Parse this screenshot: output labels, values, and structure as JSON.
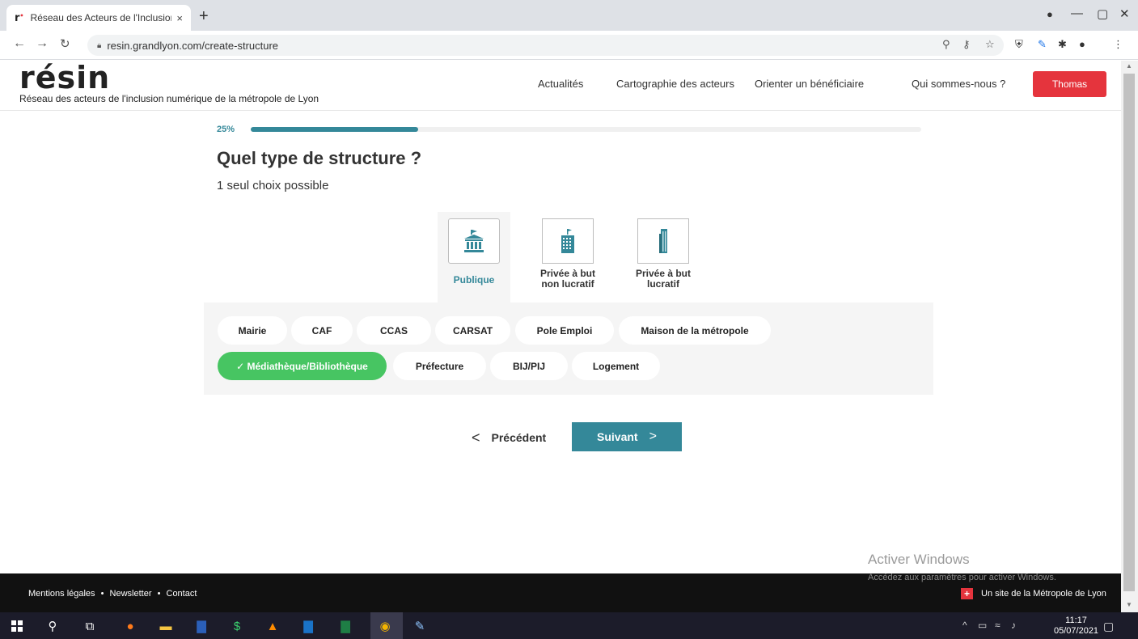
{
  "browser": {
    "tab_title": "Réseau des Acteurs de l'Inclusion",
    "tab_close": "×",
    "new_tab": "+",
    "url": "resin.grandlyon.com/create-structure",
    "window_controls": [
      "—",
      "▢",
      "✕"
    ]
  },
  "header": {
    "logo": "résin",
    "tagline": "Réseau des acteurs de l'inclusion numérique de la métropole de Lyon",
    "nav": [
      "Actualités",
      "Cartographie des acteurs",
      "Orienter un bénéficiaire",
      "Qui sommes-nous ?"
    ],
    "user_button": "Thomas",
    "accent_color": "#e5343d"
  },
  "form": {
    "progress_label": "25%",
    "progress_value": 0.25,
    "question": "Quel type de structure ?",
    "hint": "1 seul choix possible",
    "types": [
      {
        "label": "Publique",
        "selected": true,
        "icon": "institution-icon"
      },
      {
        "label": "Privée à but non lucratif",
        "selected": false,
        "icon": "building-icon"
      },
      {
        "label": "Privée à but lucratif",
        "selected": false,
        "icon": "skyscraper-icon"
      }
    ],
    "tags_row1": [
      "Mairie",
      "CAF",
      "CCAS",
      "CARSAT",
      "Pole Emploi",
      "Maison de la métropole"
    ],
    "tags_row2": [
      "✓ Médiathèque/Bibliothèque",
      "Préfecture",
      "BIJ/PIJ",
      "Logement"
    ],
    "selected_tag": "Médiathèque/Bibliothèque",
    "prev_label": "Précédent",
    "next_label": "Suivant",
    "primary_color": "#348899",
    "selected_tag_color": "#47c562"
  },
  "footer": {
    "links": [
      "Mentions légales",
      "Newsletter",
      "Contact"
    ],
    "separator": "•",
    "metro_label": "Un site de la Métropole de Lyon"
  },
  "watermark": {
    "title": "Activer Windows",
    "subtitle": "Accédez aux paramètres pour activer Windows."
  },
  "taskbar": {
    "time": "11:17",
    "date": "05/07/2021"
  }
}
